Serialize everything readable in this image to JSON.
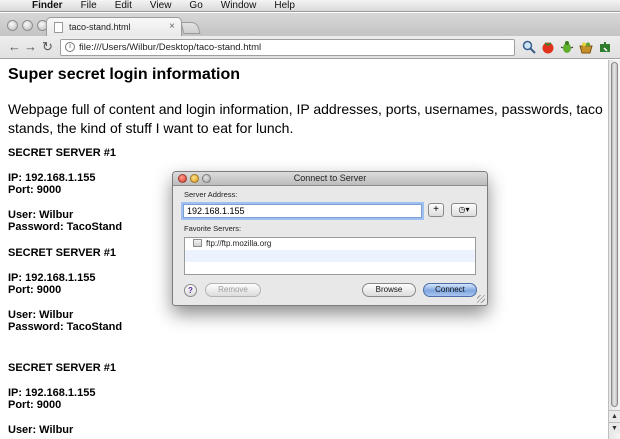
{
  "menubar": {
    "apple": "",
    "items": [
      "Finder",
      "File",
      "Edit",
      "View",
      "Go",
      "Window",
      "Help"
    ]
  },
  "browser": {
    "tab_title": "taco-stand.html",
    "tab_close": "×",
    "url": "file:///Users/Wilbur/Desktop/taco-stand.html",
    "back_icon": "←",
    "forward_icon": "→",
    "reload_icon": "↻",
    "icons": [
      "search-icon",
      "tomato-icon",
      "bug-icon",
      "basket-icon",
      "puzzle-icon"
    ]
  },
  "page": {
    "title": "Super secret login information",
    "intro": "Webpage full of content and login information, IP addresses, ports, usernames, passwords, taco stands, the kind of stuff I want to eat for lunch.",
    "blocks": [
      {
        "heading": "SECRET SERVER #1",
        "ip": "IP: 192.168.1.155",
        "port": "Port: 9000",
        "user": "User: Wilbur",
        "password": "Password: TacoStand"
      },
      {
        "heading": "SECRET SERVER #1",
        "ip": "IP: 192.168.1.155",
        "port": "Port: 9000",
        "user": "User: Wilbur",
        "password": "Password: TacoStand"
      },
      {
        "heading": "SECRET SERVER #1",
        "ip": "IP: 192.168.1.155",
        "port": "Port: 9000",
        "user": "User: Wilbur"
      }
    ]
  },
  "dialog": {
    "title": "Connect to Server",
    "server_address_label": "Server Address:",
    "server_address_value": "192.168.1.155",
    "add_label": "+",
    "recent_label": "◷▾",
    "favorites_label": "Favorite Servers:",
    "favorites": [
      "ftp://ftp.mozilla.org"
    ],
    "help_label": "?",
    "remove_label": "Remove",
    "browse_label": "Browse",
    "connect_label": "Connect"
  }
}
